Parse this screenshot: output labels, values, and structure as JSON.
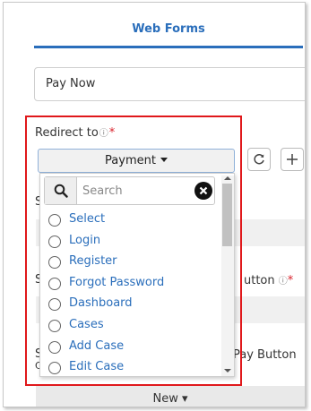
{
  "tab": {
    "label": "Web Forms"
  },
  "form_name": {
    "value": "Pay Now"
  },
  "redirect": {
    "label": "Redirect to",
    "help_icon": "question-circle-icon",
    "required_mark": "*",
    "selected": "Payment"
  },
  "toolbar_icons": {
    "refresh": "refresh-icon",
    "add": "plus-icon"
  },
  "dropdown": {
    "search_placeholder": "Search",
    "options": [
      "Select",
      "Login",
      "Register",
      "Forgot Password",
      "Dashboard",
      "Cases",
      "Add Case",
      "Edit Case"
    ]
  },
  "background": {
    "s1": "S",
    "s2": "S",
    "s3": "S",
    "c3": "C",
    "button_label_tail": "utton",
    "pay_button_tail": "Pay Button",
    "required_mark": "*",
    "new_button": "New ▾"
  },
  "colors": {
    "accent": "#2a6ebb",
    "highlight_box": "#e0181b",
    "required": "#d9232d"
  }
}
